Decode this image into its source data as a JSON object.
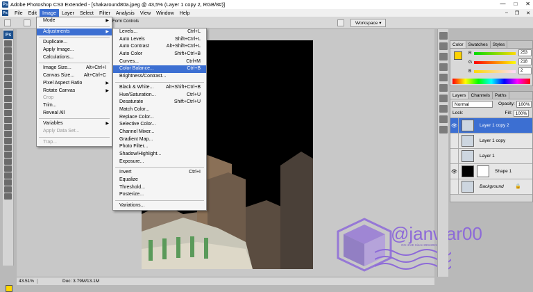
{
  "window": {
    "title": "Adobe Photoshop CS3 Extended - [shakaround80a.jpeg @ 43,5% (Layer 1 copy 2, RGB/8#)]",
    "app_icon": "Ps"
  },
  "menubar": {
    "items": [
      "File",
      "Edit",
      "Image",
      "Layer",
      "Select",
      "Filter",
      "Analysis",
      "View",
      "Window",
      "Help"
    ],
    "active": "Image"
  },
  "optionsbar": {
    "form_controls": "Form Controls",
    "workspace": "Workspace ▾"
  },
  "image_menu": [
    {
      "label": "Mode",
      "sub": true
    },
    {
      "sep": true
    },
    {
      "label": "Adjustments",
      "sub": true,
      "hl": true
    },
    {
      "sep": true
    },
    {
      "label": "Duplicate..."
    },
    {
      "label": "Apply Image..."
    },
    {
      "label": "Calculations..."
    },
    {
      "sep": true
    },
    {
      "label": "Image Size...",
      "sc": "Alt+Ctrl+I"
    },
    {
      "label": "Canvas Size...",
      "sc": "Alt+Ctrl+C"
    },
    {
      "label": "Pixel Aspect Ratio",
      "sub": true
    },
    {
      "label": "Rotate Canvas",
      "sub": true
    },
    {
      "label": "Crop",
      "dis": true
    },
    {
      "label": "Trim..."
    },
    {
      "label": "Reveal All"
    },
    {
      "sep": true
    },
    {
      "label": "Variables",
      "sub": true
    },
    {
      "label": "Apply Data Set...",
      "dis": true
    },
    {
      "sep": true
    },
    {
      "label": "Trap...",
      "dis": true
    }
  ],
  "adjustments_menu": [
    {
      "label": "Levels...",
      "sc": "Ctrl+L"
    },
    {
      "label": "Auto Levels",
      "sc": "Shift+Ctrl+L"
    },
    {
      "label": "Auto Contrast",
      "sc": "Alt+Shift+Ctrl+L"
    },
    {
      "label": "Auto Color",
      "sc": "Shift+Ctrl+B"
    },
    {
      "label": "Curves...",
      "sc": "Ctrl+M"
    },
    {
      "label": "Color Balance...",
      "sc": "Ctrl+B",
      "hl": true
    },
    {
      "label": "Brightness/Contrast..."
    },
    {
      "sep": true
    },
    {
      "label": "Black & White...",
      "sc": "Alt+Shift+Ctrl+B"
    },
    {
      "label": "Hue/Saturation...",
      "sc": "Ctrl+U"
    },
    {
      "label": "Desaturate",
      "sc": "Shift+Ctrl+U"
    },
    {
      "label": "Match Color..."
    },
    {
      "label": "Replace Color..."
    },
    {
      "label": "Selective Color..."
    },
    {
      "label": "Channel Mixer..."
    },
    {
      "label": "Gradient Map..."
    },
    {
      "label": "Photo Filter..."
    },
    {
      "label": "Shadow/Highlight..."
    },
    {
      "label": "Exposure..."
    },
    {
      "sep": true
    },
    {
      "label": "Invert",
      "sc": "Ctrl+I"
    },
    {
      "label": "Equalize"
    },
    {
      "label": "Threshold..."
    },
    {
      "label": "Posterize..."
    },
    {
      "sep": true
    },
    {
      "label": "Variations..."
    }
  ],
  "statusbar": {
    "zoom": "43.51%",
    "doc": "Doc: 3.79M/13.1M"
  },
  "color_panel": {
    "tabs": [
      "Color",
      "Swatches",
      "Styles"
    ],
    "r_label": "R",
    "g_label": "G",
    "b_label": "B",
    "r": "253",
    "g": "218",
    "b": "2",
    "fg_color": "#fdd202"
  },
  "layers_panel": {
    "tabs": [
      "Layers",
      "Channels",
      "Paths"
    ],
    "blend_mode": "Normal",
    "opacity_label": "Opacity:",
    "opacity": "100%",
    "lock_label": "Lock:",
    "fill_label": "Fill:",
    "fill": "100%",
    "layers": [
      {
        "name": "Layer 1 copy 2",
        "selected": true,
        "visible": true
      },
      {
        "name": "Layer 1 copy",
        "selected": false,
        "visible": false
      },
      {
        "name": "Layer 1",
        "selected": false,
        "visible": false
      },
      {
        "name": "Shape 1",
        "selected": false,
        "visible": true
      },
      {
        "name": "Background",
        "selected": false,
        "visible": false,
        "locked": true
      }
    ]
  },
  "watermark": {
    "text": "@janwar00",
    "sub": "ON HIVE Since 29042021"
  }
}
